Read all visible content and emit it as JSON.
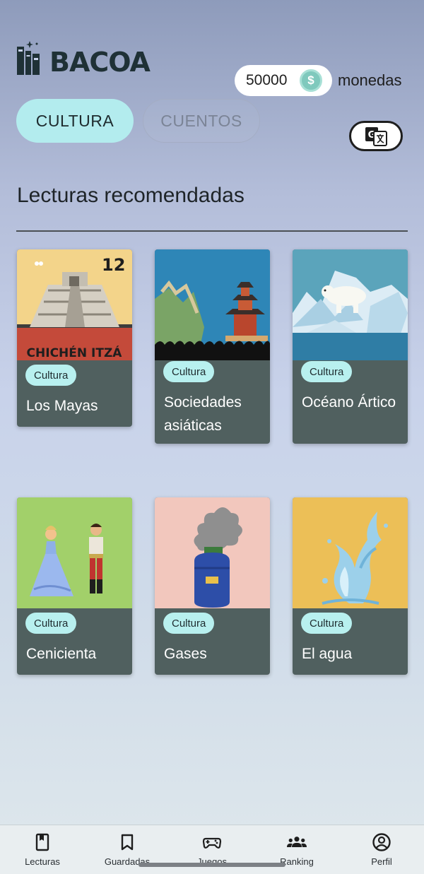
{
  "header": {
    "logo_text": "BACOA",
    "coins_value": "50000",
    "coins_label": "monedas",
    "coin_symbol": "$"
  },
  "tabs": [
    {
      "label": "CULTURA",
      "active": true
    },
    {
      "label": "CUENTOS",
      "active": false
    }
  ],
  "translate_icon": "translate-icon",
  "section": {
    "title": "Lecturas recomendadas"
  },
  "cards": [
    {
      "badge": "Cultura",
      "title": "Los Mayas",
      "cover_number": "12",
      "cover_caption": "CHICHÉN ITZÁ"
    },
    {
      "badge": "Cultura",
      "title": "Sociedades asiáticas"
    },
    {
      "badge": "Cultura",
      "title": "Océano Ártico"
    },
    {
      "badge": "Cultura",
      "title": "Cenicienta"
    },
    {
      "badge": "Cultura",
      "title": "Gases"
    },
    {
      "badge": "Cultura",
      "title": "El agua"
    }
  ],
  "nav": [
    {
      "label": "Lecturas",
      "icon": "book-icon"
    },
    {
      "label": "Guardadas",
      "icon": "bookmark-icon"
    },
    {
      "label": "Juegos",
      "icon": "gamepad-icon"
    },
    {
      "label": "Ranking",
      "icon": "group-icon"
    },
    {
      "label": "Perfil",
      "icon": "profile-icon"
    }
  ],
  "colors": {
    "accent_tab": "#b3ecee",
    "card_bg": "#50605f",
    "badge_bg": "#b8f0ef"
  }
}
